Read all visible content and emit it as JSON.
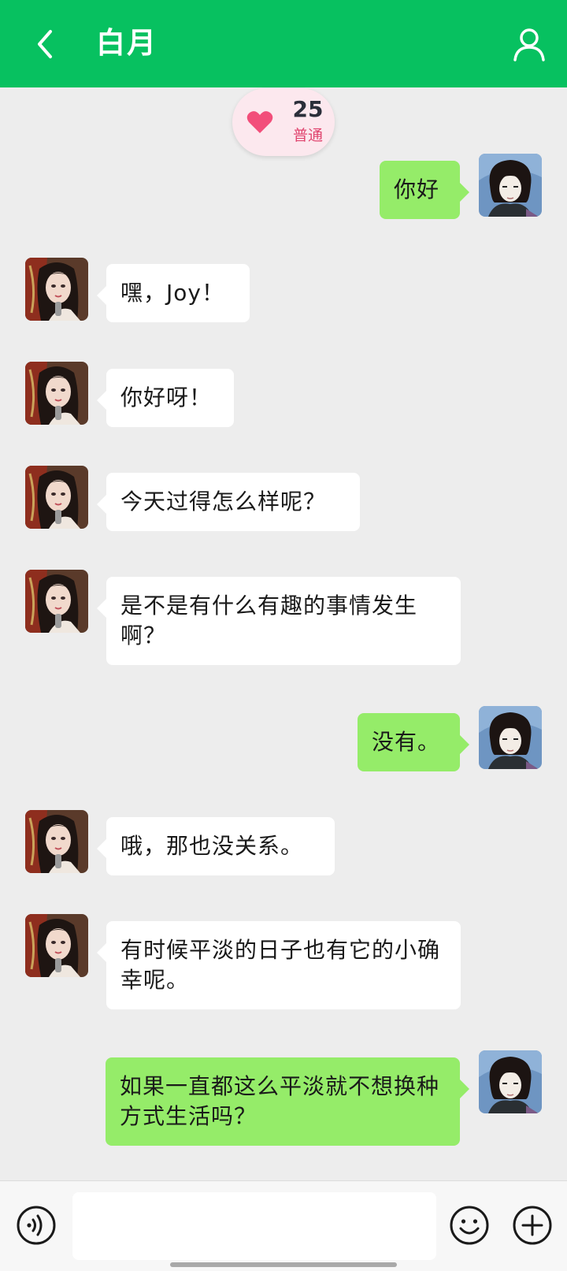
{
  "header": {
    "title": "白月",
    "back_icon": "chevron-left-icon",
    "profile_icon": "user-icon"
  },
  "intimacy": {
    "icon": "heart-icon",
    "score": "25",
    "level": "普通"
  },
  "messages": [
    {
      "sender": "me",
      "text": "你好"
    },
    {
      "sender": "contact",
      "text": "嘿，Joy！"
    },
    {
      "sender": "contact",
      "text": "你好呀！"
    },
    {
      "sender": "contact",
      "text": "今天过得怎么样呢？"
    },
    {
      "sender": "contact",
      "text": "是不是有什么有趣的事情发生啊？"
    },
    {
      "sender": "me",
      "text": "没有。"
    },
    {
      "sender": "contact",
      "text": "哦，那也没关系。"
    },
    {
      "sender": "contact",
      "text": "有时候平淡的日子也有它的小确幸呢。"
    },
    {
      "sender": "me",
      "text": "如果一直都这么平淡就不想换种方式生活吗？"
    }
  ],
  "input_bar": {
    "voice_icon": "voice-icon",
    "input_value": "",
    "emoji_icon": "emoji-icon",
    "plus_icon": "plus-icon"
  },
  "colors": {
    "header": "#07C160",
    "background": "#EDEDED",
    "outgoing_bubble": "#95EC69",
    "incoming_bubble": "#FFFFFF",
    "badge_background": "#FCE8EE",
    "heart": "#F24E7A"
  }
}
